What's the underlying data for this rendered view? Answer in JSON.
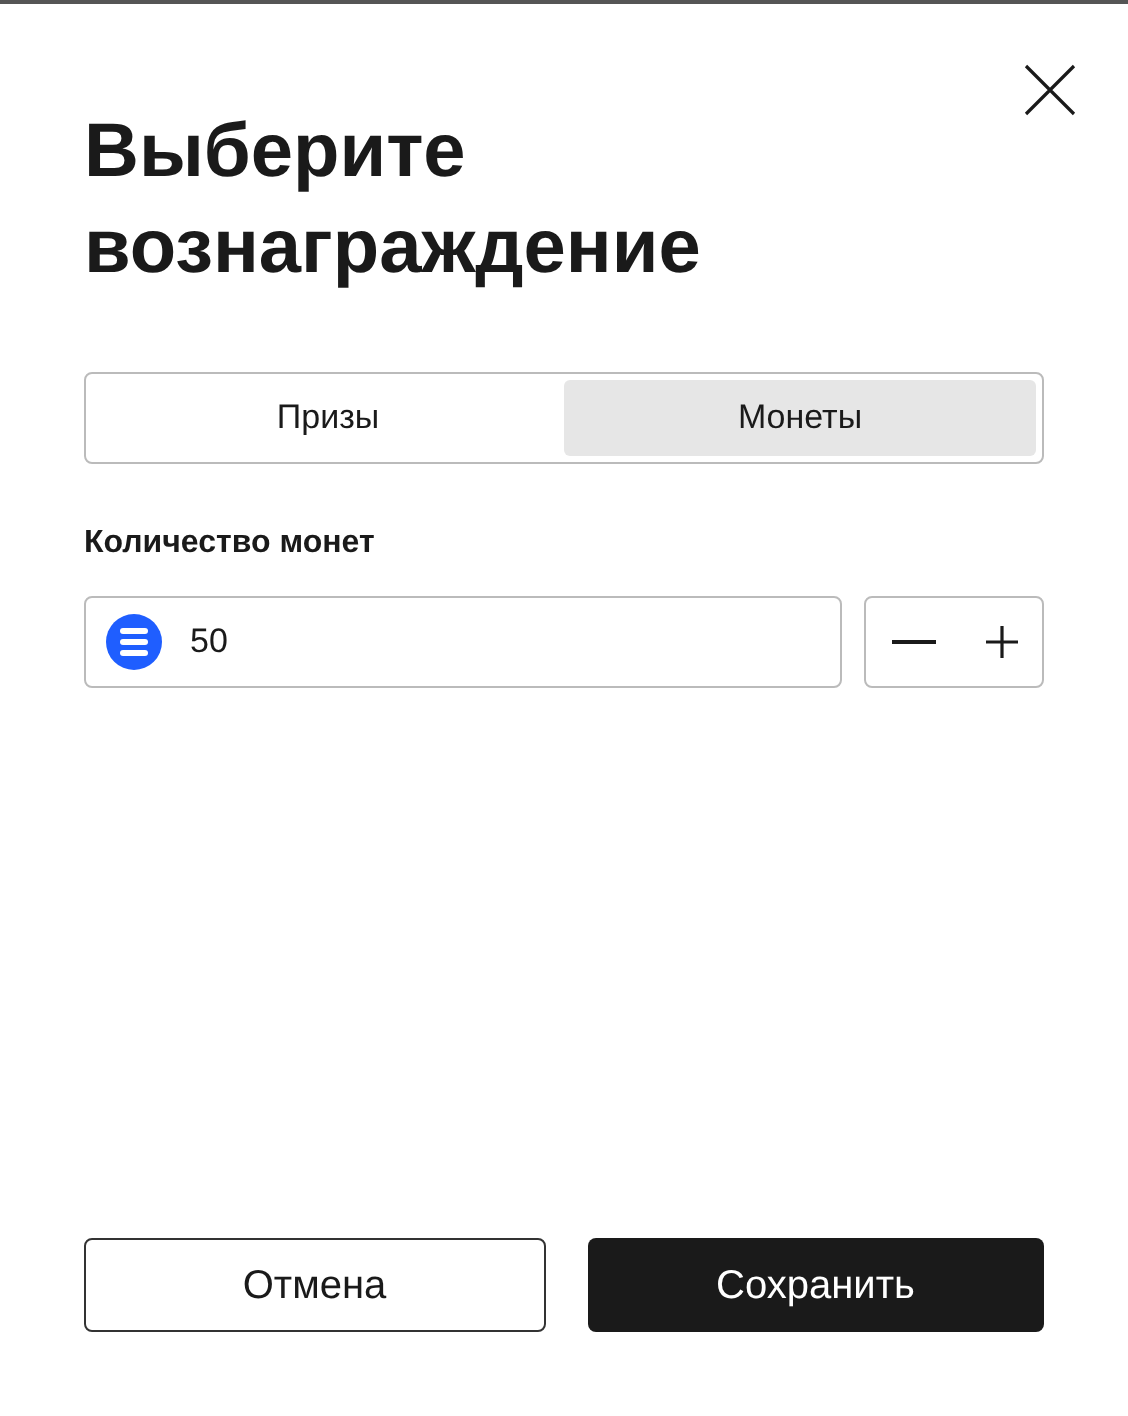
{
  "dialog": {
    "title": "Выберите вознаграждение"
  },
  "tabs": [
    {
      "label": "Призы",
      "selected": false
    },
    {
      "label": "Монеты",
      "selected": true
    }
  ],
  "coins": {
    "label": "Количество монет",
    "value": "50"
  },
  "buttons": [
    {
      "label": "Отмена",
      "kind": "secondary"
    },
    {
      "label": "Сохранить",
      "kind": "primary"
    }
  ]
}
